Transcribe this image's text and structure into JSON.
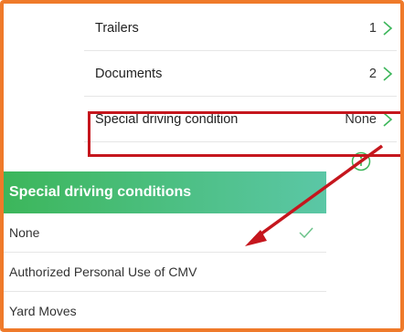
{
  "settings": {
    "rows": [
      {
        "label": "Trailers",
        "value": "1"
      },
      {
        "label": "Documents",
        "value": "2"
      },
      {
        "label": "Special driving condition",
        "value": "None"
      }
    ]
  },
  "sheet": {
    "title": "Special driving conditions",
    "options": [
      {
        "label": "None",
        "selected": true
      },
      {
        "label": "Authorized Personal Use of CMV",
        "selected": false
      },
      {
        "label": "Yard Moves",
        "selected": false
      }
    ]
  },
  "colors": {
    "frame": "#ef7a2a",
    "highlight": "#c5161d",
    "accent": "#3cb65a",
    "check": "#6cc38a"
  },
  "icons": [
    "chevron-right-icon",
    "info-icon",
    "checkmark-icon",
    "red-arrow-annotation"
  ]
}
